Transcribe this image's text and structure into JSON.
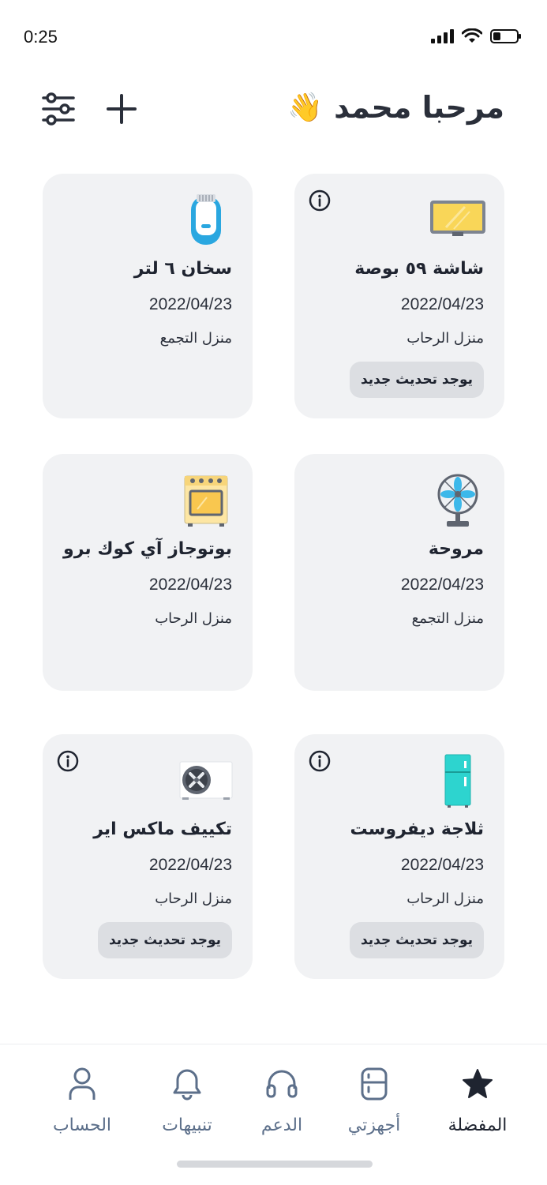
{
  "status_bar": {
    "time": "0:25"
  },
  "header": {
    "greeting": "مرحبا محمد",
    "wave_emoji": "👋"
  },
  "cards": [
    {
      "title": "شاشة ٥٩ بوصة",
      "date": "2022/04/23",
      "location": "منزل الرحاب",
      "update_label": "يوجد تحديث جديد",
      "icon": "tv-icon"
    },
    {
      "title": "سخان ٦ لتر",
      "date": "2022/04/23",
      "location": "منزل التجمع",
      "icon": "water-heater-icon"
    },
    {
      "title": "مروحة",
      "date": "2022/04/23",
      "location": "منزل التجمع",
      "icon": "fan-icon"
    },
    {
      "title": "بوتوجاز آي كوك برو",
      "date": "2022/04/23",
      "location": "منزل الرحاب",
      "icon": "oven-icon"
    },
    {
      "title": "ثلاجة ديفروست",
      "date": "2022/04/23",
      "location": "منزل الرحاب",
      "update_label": "يوجد تحديث جديد",
      "icon": "fridge-icon"
    },
    {
      "title": "تكييف ماكس  اير",
      "date": "2022/04/23",
      "location": "منزل الرحاب",
      "update_label": "يوجد تحديث جديد",
      "icon": "ac-unit-icon"
    }
  ],
  "nav": {
    "favorites": "المفضلة",
    "devices": "أجهزتي",
    "support": "الدعم",
    "notifications": "تنبيهات",
    "account": "الحساب"
  },
  "colors": {
    "accent": "#1f2430",
    "nav_inactive": "#5c6f8a",
    "card_bg": "#f1f2f4",
    "badge_bg": "#dcdee2"
  }
}
